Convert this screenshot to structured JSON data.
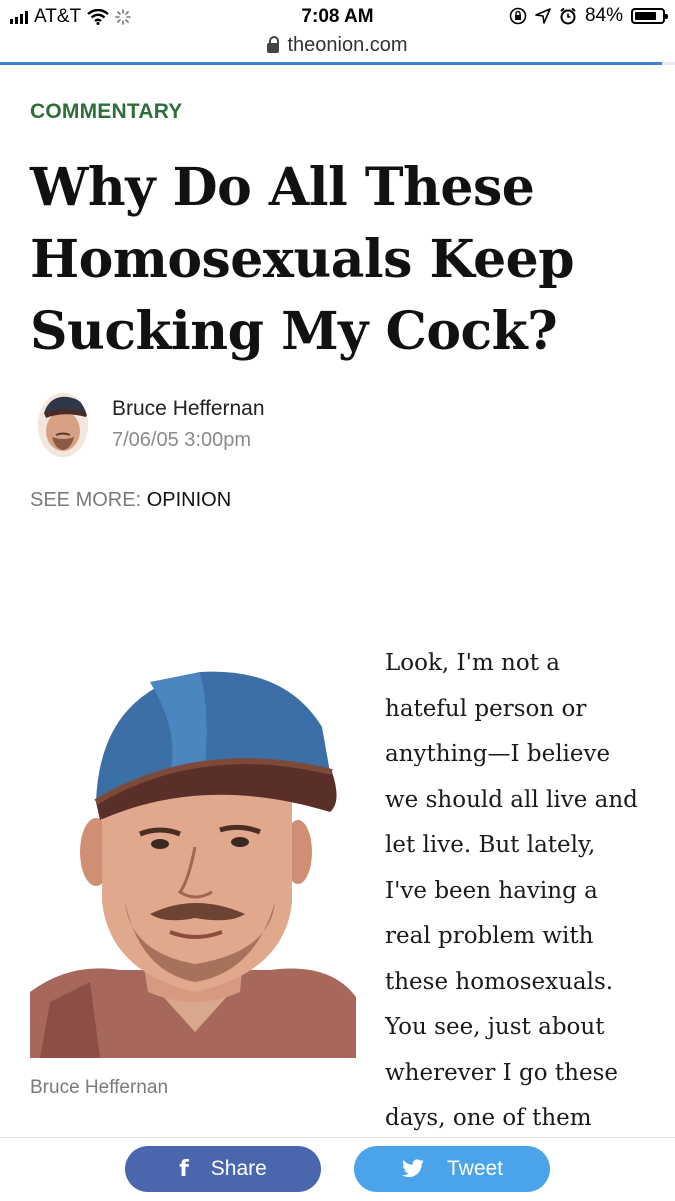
{
  "status_bar": {
    "carrier": "AT&T",
    "time": "7:08 AM",
    "battery": "84%",
    "battery_level": 0.84,
    "icons": [
      "signal-icon",
      "wifi-icon",
      "loading-icon",
      "screen-rotation-lock-icon",
      "location-icon",
      "alarm-icon",
      "battery-icon"
    ]
  },
  "browser": {
    "url": "theonion.com",
    "load_progress": 0.98,
    "accent": "#3f7fd8"
  },
  "article": {
    "section": "COMMENTARY",
    "headline": "Why Do All These Homosexuals Keep Sucking My Cock?",
    "author": "Bruce Heffernan",
    "date": "7/06/05 3:00pm",
    "see_more_label": "SEE MORE:",
    "see_more_link": "OPINION",
    "photo_caption": "Bruce Heffernan",
    "body_lines": [
      "Look, I'm not a",
      "hateful person or",
      "anything—I believe",
      "we should all live and",
      "let live. But lately,",
      "I've been having a",
      "real problem with",
      "these homosexuals.",
      "You see, just about",
      "wherever I go these",
      "days, one of them"
    ]
  },
  "share": {
    "facebook_label": "Share",
    "twitter_label": "Tweet",
    "facebook_color": "#4a67ad",
    "twitter_color": "#4ba3ea"
  },
  "colors": {
    "section": "#2e6e3b",
    "muted": "#7a7a7a"
  }
}
